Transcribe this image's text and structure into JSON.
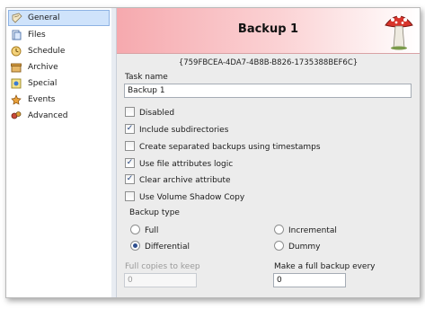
{
  "sidebar": {
    "items": [
      {
        "label": "General",
        "icon": "general-icon",
        "active": true
      },
      {
        "label": "Files",
        "icon": "files-icon",
        "active": false
      },
      {
        "label": "Schedule",
        "icon": "schedule-icon",
        "active": false
      },
      {
        "label": "Archive",
        "icon": "archive-icon",
        "active": false
      },
      {
        "label": "Special",
        "icon": "special-icon",
        "active": false
      },
      {
        "label": "Events",
        "icon": "events-icon",
        "active": false
      },
      {
        "label": "Advanced",
        "icon": "advanced-icon",
        "active": false
      }
    ]
  },
  "header": {
    "title": "Backup 1",
    "guid": "{759FBCEA-4DA7-4B8B-B826-1735388BEF6C}",
    "icon": "mushroom-icon"
  },
  "form": {
    "task_name_label": "Task name",
    "task_name_value": "Backup 1",
    "checkboxes": [
      {
        "label": "Disabled",
        "checked": false
      },
      {
        "label": "Include subdirectories",
        "checked": true
      },
      {
        "label": "Create separated backups using timestamps",
        "checked": false
      },
      {
        "label": "Use file attributes logic",
        "checked": true
      },
      {
        "label": "Clear archive attribute",
        "checked": true
      },
      {
        "label": "Use Volume Shadow Copy",
        "checked": false
      }
    ],
    "backup_type": {
      "label": "Backup type",
      "options": [
        {
          "label": "Full",
          "selected": false
        },
        {
          "label": "Incremental",
          "selected": false
        },
        {
          "label": "Differential",
          "selected": true
        },
        {
          "label": "Dummy",
          "selected": false
        }
      ]
    },
    "full_copies_label": "Full copies to keep",
    "full_copies_value": "0",
    "make_full_label": "Make a full backup every",
    "make_full_value": "0"
  }
}
